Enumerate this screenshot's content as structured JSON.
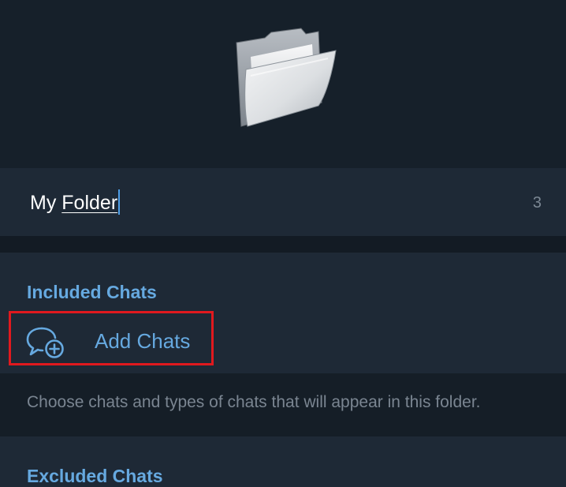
{
  "folder_name": {
    "prefix": "My ",
    "underlined_word": "Folder",
    "char_counter": "3"
  },
  "included": {
    "header": "Included Chats",
    "add_button_label": "Add Chats",
    "add_button_icon": "chat-add-icon"
  },
  "info_text": "Choose chats and types of chats that will appear in this folder.",
  "excluded": {
    "header": "Excluded Chats"
  },
  "colors": {
    "background": "#151e27",
    "section_background": "#1e2936",
    "accent": "#66a9e0",
    "highlight_border": "#e0191e"
  }
}
